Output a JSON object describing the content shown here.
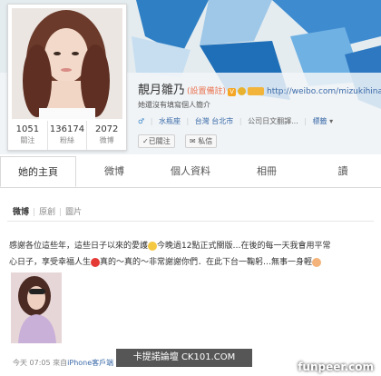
{
  "profile": {
    "stats": [
      {
        "num": "1051",
        "label": "關注"
      },
      {
        "num": "136174",
        "label": "粉絲"
      },
      {
        "num": "2072",
        "label": "微博"
      }
    ],
    "name": "靚月雛乃",
    "name_note": "(設置備註)",
    "verified_label": "V",
    "url": "http://weibo.com/mizukihinano",
    "description": "她還沒有填寫個人簡介",
    "gender_icon": "male-icon",
    "zodiac": "水瓶座",
    "location": "台灣 台北市",
    "company": "公司日文翻譯...",
    "tags_label": "標籤",
    "follow_btn": "✓已關注",
    "message_btn": "私信",
    "colors": {
      "accent": "#eb7350",
      "link": "#3b6aa8"
    }
  },
  "tabs": [
    "她的主頁",
    "微博",
    "個人資料",
    "相冊",
    "讀"
  ],
  "subtabs": [
    "微博",
    "原創",
    "圖片"
  ],
  "post": {
    "line1": "感謝各位這些年，這些日子以來的愛護",
    "line1b": "今晚過12點正式關版…在後的每一天我會用平常",
    "line2": "心日子，享受幸福人生",
    "line2b": "真的～真的～非常謝謝你們．在此下台一鞠躬…無事一身輕",
    "time": "今天 07:05",
    "source_prefix": "來自",
    "source": "iPhone客戶端"
  },
  "watermarks": {
    "left": "卡提諾論壇 CK101.COM",
    "right": "funpeer.com"
  }
}
